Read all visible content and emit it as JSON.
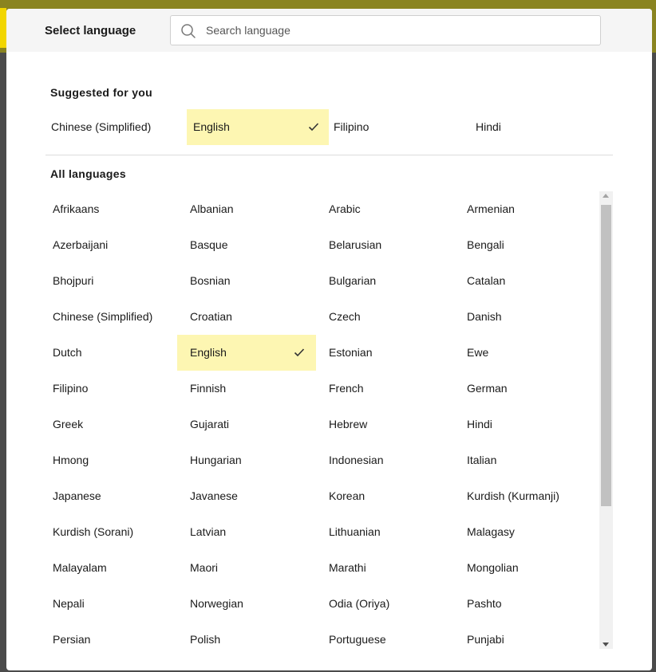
{
  "modal": {
    "title": "Select language",
    "search_placeholder": "Search language",
    "search_value": ""
  },
  "suggested": {
    "heading": "Suggested for you",
    "items": [
      {
        "label": "Chinese (Simplified)",
        "selected": false
      },
      {
        "label": "English",
        "selected": true
      },
      {
        "label": "Filipino",
        "selected": false
      },
      {
        "label": "Hindi",
        "selected": false
      }
    ]
  },
  "all_languages": {
    "heading": "All languages",
    "selected": "English",
    "rows": [
      [
        "Afrikaans",
        "Albanian",
        "Arabic",
        "Armenian"
      ],
      [
        "Azerbaijani",
        "Basque",
        "Belarusian",
        "Bengali"
      ],
      [
        "Bhojpuri",
        "Bosnian",
        "Bulgarian",
        "Catalan"
      ],
      [
        "Chinese (Simplified)",
        "Croatian",
        "Czech",
        "Danish"
      ],
      [
        "Dutch",
        "English",
        "Estonian",
        "Ewe"
      ],
      [
        "Filipino",
        "Finnish",
        "French",
        "German"
      ],
      [
        "Greek",
        "Gujarati",
        "Hebrew",
        "Hindi"
      ],
      [
        "Hmong",
        "Hungarian",
        "Indonesian",
        "Italian"
      ],
      [
        "Japanese",
        "Javanese",
        "Korean",
        "Kurdish (Kurmanji)"
      ],
      [
        "Kurdish (Sorani)",
        "Latvian",
        "Lithuanian",
        "Malagasy"
      ],
      [
        "Malayalam",
        "Maori",
        "Marathi",
        "Mongolian"
      ],
      [
        "Nepali",
        "Norwegian",
        "Odia (Oriya)",
        "Pashto"
      ],
      [
        "Persian",
        "Polish",
        "Portuguese",
        "Punjabi"
      ]
    ]
  },
  "colors": {
    "selected_bg": "#fdf6b2",
    "header_bg": "#f5f5f5",
    "backdrop": "#4b4b4b"
  },
  "icons": {
    "search": "search-icon",
    "check": "checkmark-icon",
    "scroll_up": "scroll-up-arrow-icon",
    "scroll_down": "scroll-down-arrow-icon"
  }
}
